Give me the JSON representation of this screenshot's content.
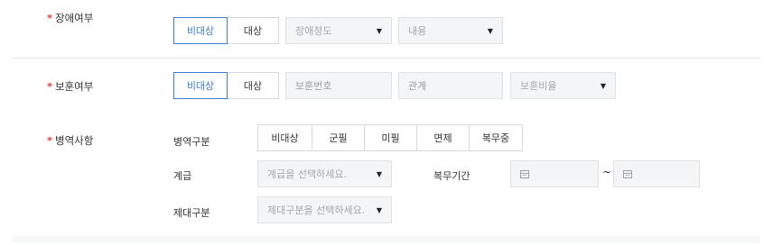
{
  "disability": {
    "label": "장애여부",
    "options": [
      "비대상",
      "대상"
    ],
    "selected": "비대상",
    "grade_select": "장애정도",
    "content_select": "내용"
  },
  "veteran": {
    "label": "보훈여부",
    "options": [
      "비대상",
      "대상"
    ],
    "selected": "비대상",
    "number_placeholder": "보훈번호",
    "relation_placeholder": "관계",
    "ratio_select": "보훈비율"
  },
  "military": {
    "label": "병역사항",
    "type_label": "병역구분",
    "types": [
      "비대상",
      "군필",
      "미필",
      "면제",
      "복무중"
    ],
    "rank_label": "계급",
    "rank_select": "계급을 선택하세요.",
    "period_label": "복무기간",
    "period_separator": "~",
    "discharge_label": "제대구분",
    "discharge_select": "제대구분을 선택하세요."
  },
  "required_mark": "*",
  "icons": {
    "dropdown": "caret-down-icon",
    "calendar": "calendar-icon"
  },
  "colors": {
    "accent": "#3f7ad6",
    "required": "#e0463c"
  }
}
